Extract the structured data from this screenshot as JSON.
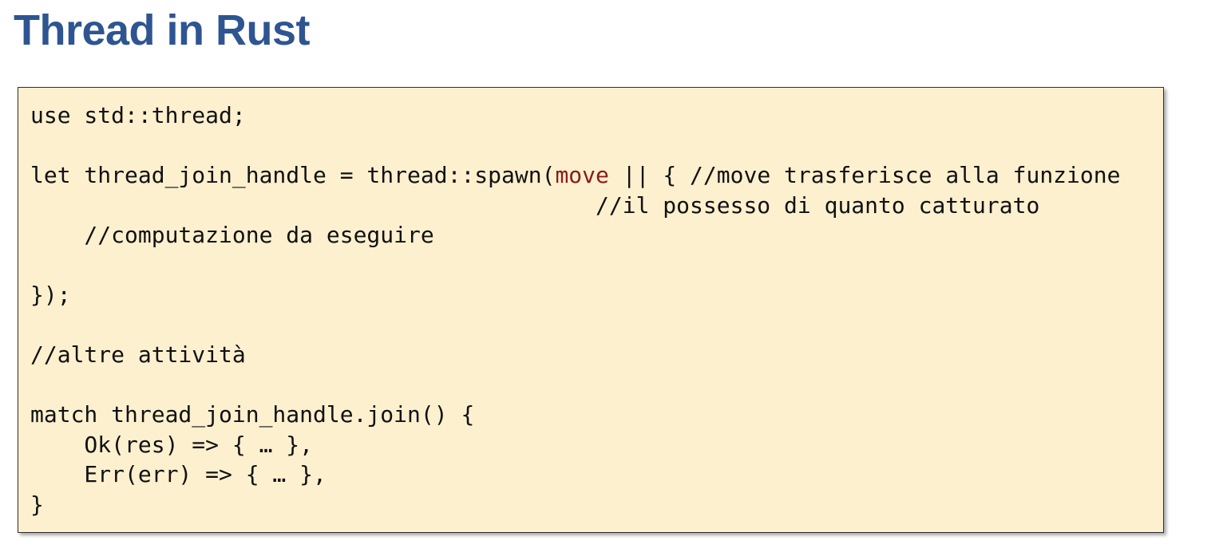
{
  "slide": {
    "title": "Thread in Rust"
  },
  "code": {
    "accent_keyword_color": "#8b1a1a",
    "lines": {
      "l1": "use std::thread;",
      "l2": "",
      "l3_pre": "let thread_join_handle = thread::spawn(",
      "l3_kw": "move",
      "l3_post": " || { //move trasferisce alla funzione",
      "l4": "                                          //il possesso di quanto catturato",
      "l5": "    //computazione da eseguire",
      "l6": "",
      "l7": "});",
      "l8": "",
      "l9": "//altre attività",
      "l10": "",
      "l11": "match thread_join_handle.join() {",
      "l12": "    Ok(res) => { … },",
      "l13": "    Err(err) => { … },",
      "l14": "}"
    }
  }
}
